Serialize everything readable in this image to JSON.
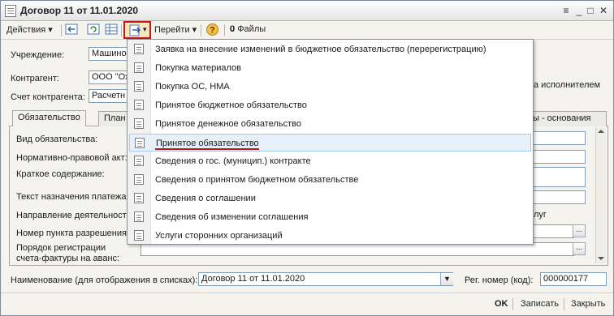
{
  "window": {
    "title": "Договор 11 от 11.01.2020"
  },
  "toolbar": {
    "actions_label": "Действия",
    "goto_label": "Перейти",
    "files_label": "Файлы",
    "help_glyph": "?"
  },
  "form": {
    "institution_label": "Учреждение:",
    "institution_value": "Машинос",
    "counterparty_label": "Контрагент:",
    "counterparty_value": "ООО \"Ох",
    "account_label": "Счет контрагента:",
    "account_value": "Расчетн",
    "performer_fragment": "а исполнителем"
  },
  "tabs": [
    {
      "label": "Обязательство"
    },
    {
      "label": "План"
    },
    {
      "label": "ы - основания"
    }
  ],
  "obligation_fields": {
    "type_label": "Вид обязательства:",
    "legal_act_label": "Нормативно-правовой акт:",
    "summary_label": "Краткое содержание:",
    "payment_purpose_label": "Текст назначения платежа:",
    "direction_label": "Направление деятельности:",
    "direction_fragment": "луг",
    "permit_number_label": "Номер пункта разрешения:",
    "invoice_order_label_line1": "Порядок регистрации",
    "invoice_order_label_line2": "счета-фактуры на аванс:"
  },
  "dropdown_menu": {
    "items": [
      {
        "label": "Заявка на внесение изменений в бюджетное обязательство (перерегистрацию)"
      },
      {
        "label": "Покупка материалов"
      },
      {
        "label": "Покупка ОС, НМА"
      },
      {
        "label": "Принятое бюджетное обязательство"
      },
      {
        "label": "Принятое денежное обязательство"
      },
      {
        "label": "Принятое обязательство",
        "highlighted": true
      },
      {
        "label": "Сведения о гос. (муницип.) контракте"
      },
      {
        "label": "Сведения о принятом бюджетном обязательстве"
      },
      {
        "label": "Сведения о соглашении"
      },
      {
        "label": "Сведения об изменении соглашения"
      },
      {
        "label": "Услуги сторонних организаций"
      }
    ]
  },
  "bottom": {
    "name_label": "Наименование (для отображения в списках):",
    "name_value": "Договор 11 от 11.01.2020",
    "reg_label": "Рег. номер (код):",
    "reg_value": "000000177"
  },
  "footer": {
    "ok_label": "OK",
    "write_label": "Записать",
    "close_label": "Закрыть"
  },
  "colors": {
    "highlight": "#e6f0fb",
    "annotation_red": "#c4161c",
    "field_border": "#7f9db9"
  }
}
